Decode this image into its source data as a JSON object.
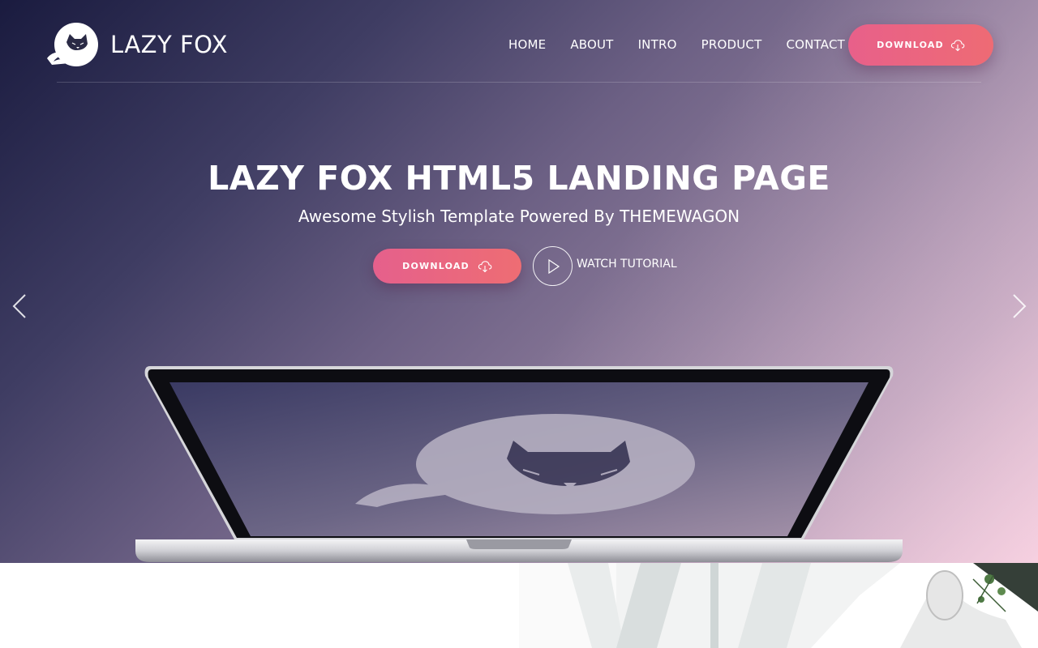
{
  "brand": {
    "name": "LAZY FOX",
    "logo_icon": "fox-logo-icon"
  },
  "nav": {
    "items": [
      {
        "label": "HOME"
      },
      {
        "label": "ABOUT"
      },
      {
        "label": "INTRO"
      },
      {
        "label": "PRODUCT"
      },
      {
        "label": "CONTACT"
      }
    ],
    "download_label": "DOWNLOAD",
    "download_icon": "cloud-download-icon"
  },
  "hero": {
    "title": "LAZY FOX HTML5 LANDING PAGE",
    "subtitle": "Awesome Stylish Template Powered By THEMEWAGON",
    "download_label": "DOWNLOAD",
    "download_icon": "cloud-download-icon",
    "watch_label": "WATCH TUTORIAL",
    "play_icon": "play-icon",
    "prev_icon": "chevron-left-icon",
    "next_icon": "chevron-right-icon"
  },
  "colors": {
    "accent_start": "#e8608a",
    "accent_end": "#ee6b74",
    "hero_dark": "#1a1b3f",
    "hero_light": "#efc7d8"
  }
}
